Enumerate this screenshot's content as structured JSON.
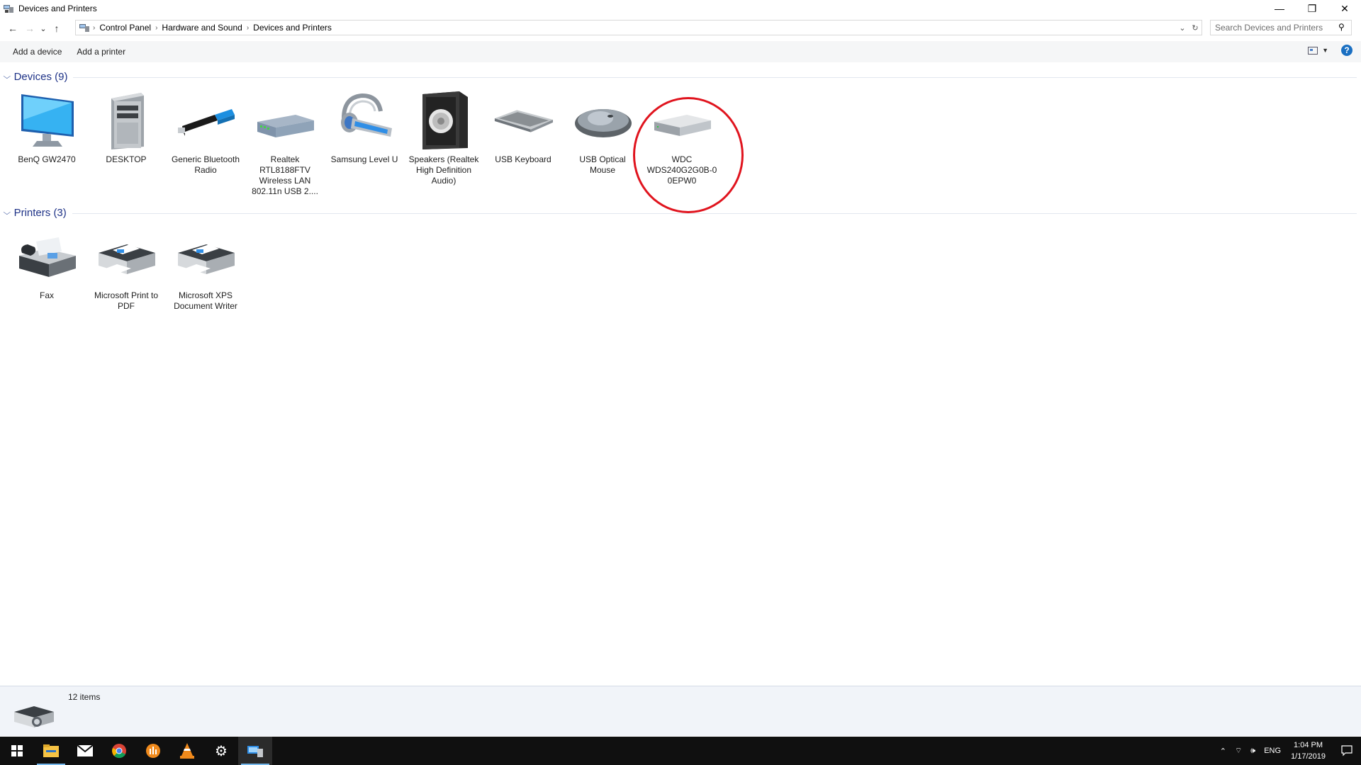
{
  "window": {
    "title": "Devices and Printers",
    "controls": {
      "minimize": "—",
      "restore": "❐",
      "close": "✕"
    }
  },
  "nav": {
    "back": "←",
    "forward": "→",
    "recent": "⌄",
    "up": "↑"
  },
  "breadcrumb": [
    "Control Panel",
    "Hardware and Sound",
    "Devices and Printers"
  ],
  "search": {
    "placeholder": "Search Devices and Printers"
  },
  "commands": {
    "add_device": "Add a device",
    "add_printer": "Add a printer",
    "help": "?"
  },
  "groups": {
    "devices": {
      "title": "Devices (9)",
      "items": [
        {
          "label": "BenQ GW2470",
          "icon": "monitor-icon"
        },
        {
          "label": "DESKTOP",
          "icon": "computer-tower-icon"
        },
        {
          "label": "Generic Bluetooth Radio",
          "icon": "usb-bluetooth-dongle-icon"
        },
        {
          "label": "Realtek RTL8188FTV Wireless LAN 802.11n USB 2....",
          "icon": "network-adapter-icon"
        },
        {
          "label": "Samsung Level U",
          "icon": "headset-icon"
        },
        {
          "label": "Speakers (Realtek High Definition Audio)",
          "icon": "speaker-icon"
        },
        {
          "label": "USB Keyboard",
          "icon": "keyboard-icon"
        },
        {
          "label": "USB Optical Mouse",
          "icon": "mouse-icon"
        },
        {
          "label": "WDC WDS240G2G0B-0 0EPW0",
          "icon": "hard-drive-icon"
        }
      ]
    },
    "printers": {
      "title": "Printers (3)",
      "items": [
        {
          "label": "Fax",
          "icon": "fax-icon"
        },
        {
          "label": "Microsoft Print to PDF",
          "icon": "printer-icon"
        },
        {
          "label": "Microsoft XPS Document Writer",
          "icon": "printer-icon"
        }
      ]
    }
  },
  "details": {
    "count": "12 items"
  },
  "tray": {
    "lang": "ENG",
    "time": "1:04 PM",
    "date": "1/17/2019"
  },
  "colors": {
    "highlight": "#e0141e",
    "group_title": "#1e3287",
    "taskbar": "#101010"
  }
}
